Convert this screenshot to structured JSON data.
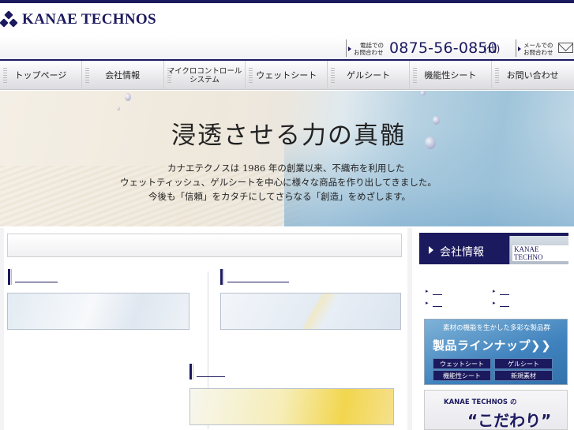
{
  "header": {
    "logo_text": "KANAE TECHNOS",
    "phone_caption_line1": "電話での",
    "phone_caption_line2": "お問合わせ",
    "phone_number": "0875-56-0850",
    "phone_suffix": "(代)",
    "mail_caption_line1": "メールでの",
    "mail_caption_line2": "お問合わせ",
    "brand_color": "#1c1a5e"
  },
  "nav": {
    "items": [
      {
        "label": "トップページ"
      },
      {
        "label": "会社情報"
      },
      {
        "label_line1": "マイクロコントロール",
        "label_line2": "システム"
      },
      {
        "label": "ウェットシート"
      },
      {
        "label": "ゲルシート"
      },
      {
        "label": "機能性シート"
      },
      {
        "label": "お問い合わせ"
      }
    ]
  },
  "hero": {
    "title": "浸透させる力の真髄",
    "lines": [
      "カナエテクノスは 1986 年の創業以来、不織布を利用した",
      "ウェットティッシュ、ゲルシートを中心に様々な商品を作り出してきました。",
      "今後も「信頼」をカタチにしてさらなる「創造」をめざします。"
    ]
  },
  "sidebar": {
    "company_header": "会社情報",
    "building_sign": "KANAE TECHNO",
    "lineup_sub": "素材の機能を生かした多彩な製品群",
    "lineup_title": "製品ラインナップ❯❯",
    "lineup_buttons": [
      "ウェットシート",
      "ゲルシート",
      "機能性シート",
      "新規素材"
    ],
    "kodawari_logo": "KANAE TECHNOS の",
    "kodawari_text": "“こだわり”"
  },
  "icons": {
    "logo": "kanae-logo-mark",
    "mail": "mail-icon",
    "arrow": "triangle-arrow-icon"
  }
}
